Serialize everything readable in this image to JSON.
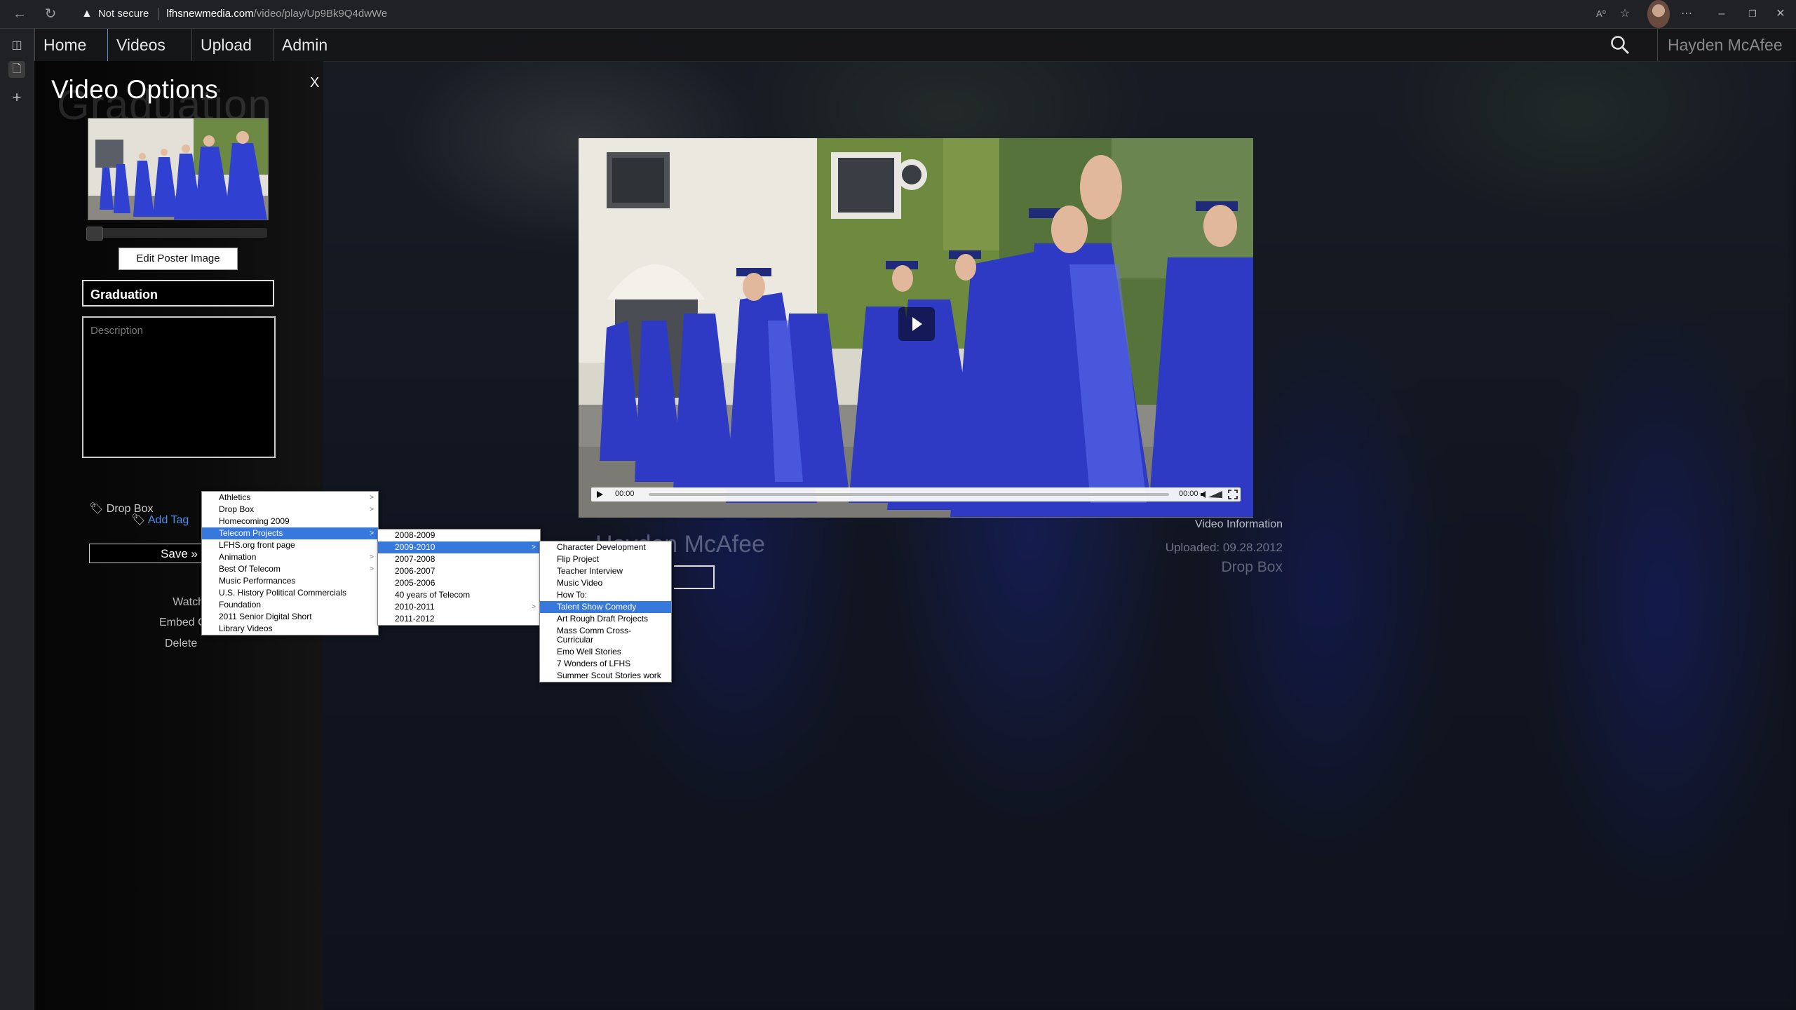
{
  "browser": {
    "security_label": "Not secure",
    "url_host": "lfhsnewmedia.com",
    "url_path": "/video/play/Up9Bk9Q4dwWe"
  },
  "nav": {
    "items": [
      "Home",
      "Videos",
      "Upload",
      "Admin"
    ],
    "user": "Hayden McAfee"
  },
  "panel": {
    "title": "Video Options",
    "ghost_title": "Graduation",
    "close": "X",
    "edit_poster": "Edit Poster Image",
    "title_value": "Graduation",
    "description_placeholder": "Description",
    "tag_existing": "Drop Box",
    "add_tag": "Add Tag",
    "save": "Save »",
    "watch": "Watch",
    "embed": "Embed Co",
    "delete": "Delete"
  },
  "player": {
    "current_time": "00:00",
    "duration": "00:00",
    "progress": 0
  },
  "info": {
    "heading": "Video Information",
    "uploaded": "Uploaded: 09.28.2012",
    "tag": "Drop Box",
    "owner_ghost": "Hayden McAfee"
  },
  "menus": {
    "level1": [
      {
        "label": "Athletics",
        "sub": true
      },
      {
        "label": "Drop Box",
        "sub": true
      },
      {
        "label": "Homecoming 2009",
        "sub": false
      },
      {
        "label": "Telecom Projects",
        "sub": true,
        "selected": true
      },
      {
        "label": "LFHS.org front page",
        "sub": false
      },
      {
        "label": "Animation",
        "sub": true
      },
      {
        "label": "Best Of Telecom",
        "sub": true
      },
      {
        "label": "Music Performances",
        "sub": false
      },
      {
        "label": "U.S. History Political Commercials",
        "sub": false
      },
      {
        "label": "Foundation",
        "sub": false
      },
      {
        "label": "2011 Senior Digital Short",
        "sub": false
      },
      {
        "label": "Library Videos",
        "sub": false
      }
    ],
    "level2": [
      {
        "label": "2008-2009",
        "sub": false
      },
      {
        "label": "2009-2010",
        "sub": true,
        "selected": true
      },
      {
        "label": "2007-2008",
        "sub": false
      },
      {
        "label": "2006-2007",
        "sub": false
      },
      {
        "label": "2005-2006",
        "sub": false
      },
      {
        "label": "40 years of Telecom",
        "sub": false
      },
      {
        "label": "2010-2011",
        "sub": true
      },
      {
        "label": "2011-2012",
        "sub": false
      }
    ],
    "level3": [
      {
        "label": "Character Development"
      },
      {
        "label": "Flip Project"
      },
      {
        "label": "Teacher Interview"
      },
      {
        "label": "Music Video"
      },
      {
        "label": "How To:"
      },
      {
        "label": "Talent Show Comedy",
        "selected": true
      },
      {
        "label": "Art Rough Draft Projects"
      },
      {
        "label": "Mass Comm Cross-Curricular",
        "tall": true
      },
      {
        "label": "Emo Well Stories"
      },
      {
        "label": "7 Wonders of LFHS"
      },
      {
        "label": "Summer Scout Stories work"
      }
    ]
  }
}
